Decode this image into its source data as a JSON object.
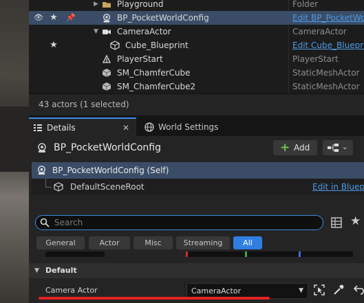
{
  "outliner": {
    "rows": [
      {
        "name": "Playground",
        "type": "Folder",
        "type_is_link": false,
        "indent": 0,
        "visible": false,
        "starred": false,
        "pinned": false,
        "selected": false,
        "icon": "folder-icon"
      },
      {
        "name": "BP_PocketWorldConfig",
        "type": "Edit BP_PocketWorldConfig",
        "type_is_link": true,
        "indent": 0,
        "visible": true,
        "starred": true,
        "pinned": true,
        "selected": true,
        "icon": "blueprint-actor-icon"
      },
      {
        "name": "CameraActor",
        "type": "CameraActor",
        "type_is_link": false,
        "indent": 0,
        "visible": false,
        "starred": false,
        "pinned": false,
        "selected": false,
        "icon": "camera-icon",
        "expanded": true
      },
      {
        "name": "Cube_Blueprint",
        "type": "Edit Cube_Blueprint",
        "type_is_link": true,
        "indent": 1,
        "visible": false,
        "starred": true,
        "pinned": false,
        "selected": false,
        "icon": "cube-icon"
      },
      {
        "name": "PlayerStart",
        "type": "PlayerStart",
        "type_is_link": false,
        "indent": 0,
        "visible": false,
        "starred": false,
        "pinned": false,
        "selected": false,
        "icon": "player-start-icon"
      },
      {
        "name": "SM_ChamferCube",
        "type": "StaticMeshActor",
        "type_is_link": false,
        "indent": 0,
        "visible": false,
        "starred": false,
        "pinned": false,
        "selected": false,
        "icon": "static-mesh-icon"
      },
      {
        "name": "SM_ChamferCube2",
        "type": "StaticMeshActor",
        "type_is_link": false,
        "indent": 0,
        "visible": false,
        "starred": false,
        "pinned": false,
        "selected": false,
        "icon": "static-mesh-icon"
      }
    ],
    "status": "43 actors (1 selected)"
  },
  "tabs": {
    "details": "Details",
    "world_settings": "World Settings"
  },
  "details": {
    "title": "BP_PocketWorldConfig",
    "add_label": "Add",
    "component_tree": {
      "root": "BP_PocketWorldConfig (Self)",
      "child": "DefaultSceneRoot",
      "child_link": "Edit in Blueprint"
    },
    "search_placeholder": "Search",
    "filters": [
      "General",
      "Actor",
      "Misc",
      "Streaming",
      "All"
    ],
    "active_filter": "All",
    "section": "Default",
    "property": {
      "label": "Camera Actor",
      "value": "CameraActor"
    }
  },
  "colors": {
    "accent": "#2f7fe3",
    "selection": "#3a4c66",
    "link": "#4d9be6",
    "annotation": "#e52222"
  }
}
